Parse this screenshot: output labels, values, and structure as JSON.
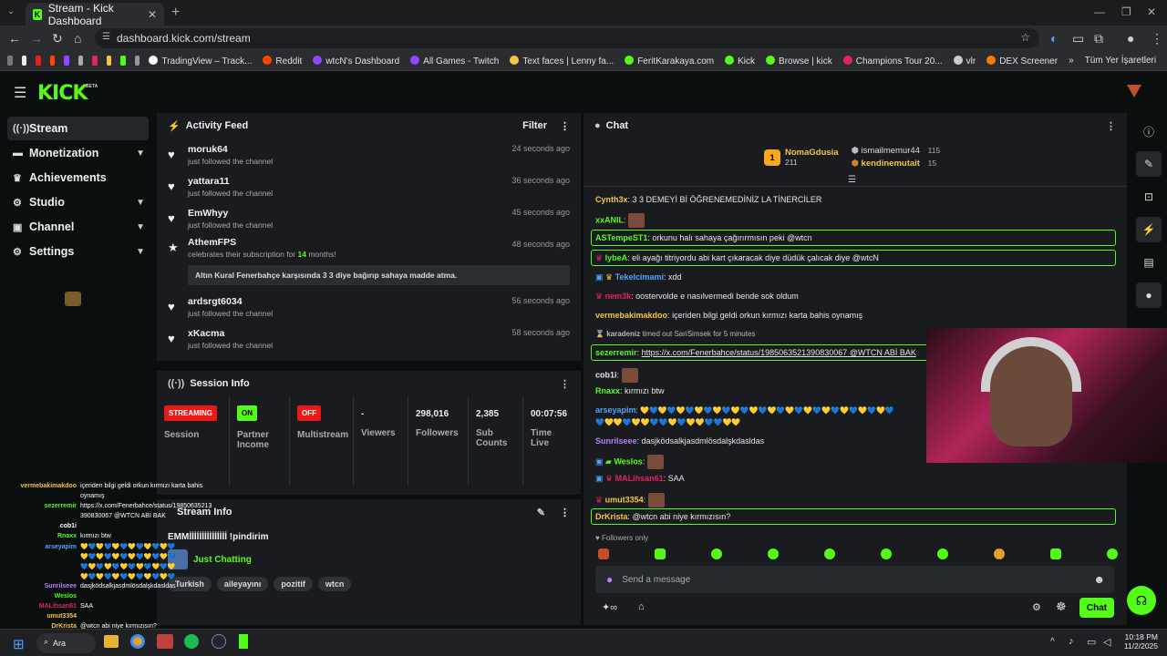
{
  "browser": {
    "tab_title": "Stream - Kick Dashboard",
    "url": "dashboard.kick.com/stream",
    "bookmarks": [
      "TradingView – Track...",
      "Reddit",
      "wtcN's Dashboard",
      "All Games - Twitch",
      "Text faces | Lenny fa...",
      "FeritKarakaya.com",
      "Kick",
      "Browse | kick",
      "Champions Tour 20...",
      "vlr",
      "DEX Screener"
    ],
    "all_bookmarks": "Tüm Yer İşaretleri"
  },
  "brand": {
    "logo": "KICK",
    "beta": "BETA",
    "accent": "#53fc18"
  },
  "sidebar": {
    "items": [
      {
        "label": "Stream",
        "icon": "broadcast-icon",
        "glyph": "((·))",
        "chevron": false,
        "active": true
      },
      {
        "label": "Monetization",
        "icon": "money-icon",
        "glyph": "▬",
        "chevron": true,
        "active": false
      },
      {
        "label": "Achievements",
        "icon": "trophy-icon",
        "glyph": "♛",
        "chevron": false,
        "active": false
      },
      {
        "label": "Studio",
        "icon": "studio-icon",
        "glyph": "⚙",
        "chevron": true,
        "active": false
      },
      {
        "label": "Channel",
        "icon": "channel-icon",
        "glyph": "▣",
        "chevron": true,
        "active": false
      },
      {
        "label": "Settings",
        "icon": "gear-icon",
        "glyph": "⚙",
        "chevron": true,
        "active": false
      }
    ]
  },
  "activity": {
    "title": "Activity Feed",
    "filter": "Filter",
    "items": [
      {
        "name": "moruk64",
        "text": "just followed the channel",
        "time": "24 seconds ago"
      },
      {
        "name": "yattara11",
        "text": "just followed the channel",
        "time": "36 seconds ago"
      },
      {
        "name": "EmWhyy",
        "text": "just followed the channel",
        "time": "45 seconds ago"
      }
    ],
    "sub": {
      "name": "AthemFPS",
      "text_pre": "celebrates their subscription for ",
      "months": "14",
      "text_post": " months!",
      "time": "48 seconds ago",
      "message": "Altın Kural Fenerbahçe karşısında 3 3 diye bağırıp sahaya madde atma."
    },
    "items2": [
      {
        "name": "ardsrgt6034",
        "text": "just followed the channel",
        "time": "56 seconds ago"
      },
      {
        "name": "xKacma",
        "text": "just followed the channel",
        "time": "58 seconds ago"
      }
    ]
  },
  "session": {
    "title": "Session Info",
    "cells": [
      {
        "badge": "STREAMING",
        "badge_color": "#e91916",
        "label": "Session"
      },
      {
        "badge": "ON",
        "badge_color": "#53fc18",
        "label": "Partner Income"
      },
      {
        "badge": "OFF",
        "badge_color": "#e91916",
        "label": "Multistream"
      },
      {
        "value": "-",
        "label": "Viewers"
      },
      {
        "value": "298,016",
        "label": "Followers"
      },
      {
        "value": "2,385",
        "label": "Sub Counts"
      },
      {
        "value": "00:07:56",
        "label": "Time Live"
      }
    ]
  },
  "stream_info": {
    "title": "Stream Info",
    "stream_title": "EMMİİİİİİİİİİİİİİİ !pindirim",
    "category": "Just Chatting",
    "tags": [
      "Turkish",
      "aileyayını",
      "pozitif",
      "wtcn"
    ]
  },
  "chat": {
    "title": "Chat",
    "leaders": {
      "first": {
        "rank": "1",
        "name": "NomaGdusia",
        "count": "211"
      },
      "second": {
        "name": "ismailmemur44",
        "count": "115"
      },
      "third": {
        "name": "kendinemutait",
        "count": "15"
      }
    },
    "messages": [
      {
        "user": "Cynth3x",
        "color": "#f5c542",
        "text": "3 3 DEMEYİ Bİ ÖĞRENEMEDİNİZ LA TİNERCİLER",
        "hl": false,
        "emote": false
      },
      {
        "user": "xxANIL",
        "color": "#53fc18",
        "text": "",
        "hl": false,
        "emote": true
      },
      {
        "user": "ASTempeST1",
        "color": "#53fc18",
        "text": "orkunu halı sahaya çağırırmısın peki @wtcn",
        "hl": true,
        "emote": false
      },
      {
        "user": "lybeA",
        "color": "#53fc18",
        "text": "eli ayağı titriyordu abi kart çıkaracak diye düdük çalıcak diye @wtcN",
        "hl": true,
        "emote": false
      },
      {
        "user": "Tekelcimami",
        "color": "#4fa3ff",
        "text": "xdd",
        "hl": false,
        "emote": false
      },
      {
        "user": "nem3k",
        "color": "#e0245e",
        "text": "oostervolde e nasılvermedi bende sok oldum",
        "hl": false,
        "emote": false
      },
      {
        "user": "vermebakimakdoo",
        "color": "#f5c542",
        "text": "içeriden bilgi geldi orkun kırmızı karta bahis oynamış",
        "hl": false,
        "emote": false
      },
      {
        "user": "karadeniz",
        "color": "#bbbbbb",
        "text": "timed out SariSimsek for 5 minutes",
        "hl": false,
        "emote": false
      },
      {
        "user": "sezerremir",
        "color": "#53fc18",
        "text": "https://x.com/Fenerbahce/status/1985063521390830067 @WTCN ABİ BAK",
        "hl": true,
        "emote": false
      },
      {
        "user": "cob1i",
        "color": "#ffffff",
        "text": "",
        "hl": false,
        "emote": true
      },
      {
        "user": "Rnaxx",
        "color": "#53fc18",
        "text": "kırmızı btw",
        "hl": false,
        "emote": false
      },
      {
        "user": "arseyapim",
        "color": "#4fa3ff",
        "text": "💛💙💛💙💛💙💛💙💛💙💛💙💛💙💛💙💛💙💛💙💛💙💛💙💛💙💛💙",
        "hl": false,
        "emote": false
      },
      {
        "user": "",
        "color": "#4fa3ff",
        "text": "💙💛💛💙💛💛💙💙💛💙💛💛💙💙💛💛",
        "hl": false,
        "emote": false
      },
      {
        "user": "Sunrilseee",
        "color": "#b77cff",
        "text": "dasjködsalkjasdmlösdalşkdasldas",
        "hl": false,
        "emote": false
      },
      {
        "user": "Weslos",
        "color": "#53fc18",
        "text": "",
        "hl": false,
        "emote": true
      },
      {
        "user": "MALihsan61",
        "color": "#e0245e",
        "text": "SAA",
        "hl": false,
        "emote": false
      },
      {
        "user": "umut3354",
        "color": "#f5c542",
        "text": "",
        "hl": false,
        "emote": true
      },
      {
        "user": "DrKrista",
        "color": "#f5c542",
        "text": "@wtcn abi niye kırmızısın?",
        "hl": true,
        "emote": false
      }
    ],
    "followers_only": "Followers only",
    "placeholder": "Send a message",
    "send": "Chat"
  },
  "overlay": [
    {
      "user": "vermebakimakdoo",
      "color": "#f5c542",
      "text": "içeriden bilgi geldi orkun kırmızı karta bahis"
    },
    {
      "user": "",
      "color": "#fff",
      "text": "oynamış"
    },
    {
      "user": "sezerremir",
      "color": "#53fc18",
      "text": "https://x.com/Fenerbahce/status/19850635213"
    },
    {
      "user": "",
      "color": "#fff",
      "text": "390830067 @WTCN ABİ BAK"
    },
    {
      "user": "cob1i",
      "color": "#fff",
      "text": ""
    },
    {
      "user": "Rnaxx",
      "color": "#53fc18",
      "text": "kırmızı btw"
    },
    {
      "user": "arseyapim",
      "color": "#4fa3ff",
      "text": "💛💙💛💙💛💙💛💙💛💙💛💙"
    },
    {
      "user": "",
      "color": "#fff",
      "text": "💛💙💛💙💛💙💛💙💛💙💛💙"
    },
    {
      "user": "",
      "color": "#fff",
      "text": "💙💛💙💛💙💛💙💛💙💛💙💛"
    },
    {
      "user": "",
      "color": "#fff",
      "text": "💛💙💛💙💛💙💛💙💛💙💛💙"
    },
    {
      "user": "Sunrilseee",
      "color": "#b77cff",
      "text": "dasjködsalkjasdmlösdalşkdasldas"
    },
    {
      "user": "Weslos",
      "color": "#53fc18",
      "text": ""
    },
    {
      "user": "MALihsan61",
      "color": "#e0245e",
      "text": "SAA"
    },
    {
      "user": "umut3354",
      "color": "#f5c542",
      "text": ""
    },
    {
      "user": "DrKrista",
      "color": "#f5c542",
      "text": "@wtcn abi niye kırmızısın?"
    }
  ],
  "taskbar": {
    "search": "Ara",
    "time": "10:18 PM",
    "date": "11/2/2025"
  }
}
